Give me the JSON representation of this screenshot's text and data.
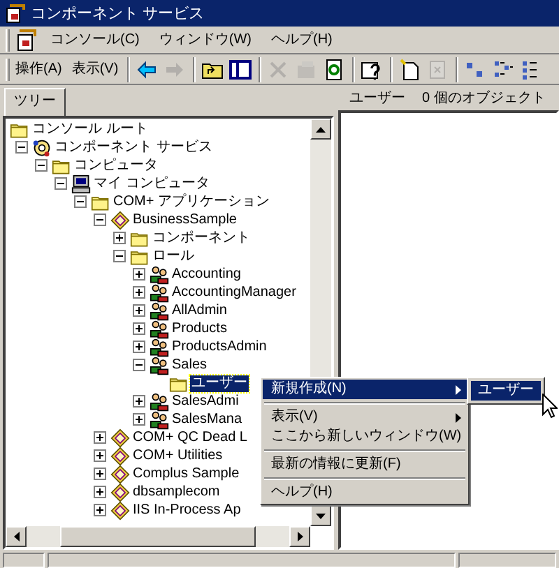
{
  "window": {
    "title": "コンポーネント サービス"
  },
  "menu_bar": [
    {
      "label": "コンソール(C)"
    },
    {
      "label": "ウィンドウ(W)"
    },
    {
      "label": "ヘルプ(H)"
    }
  ],
  "toolbar": {
    "menus": [
      {
        "label": "操作(A)"
      },
      {
        "label": "表示(V)"
      }
    ],
    "buttons": [
      {
        "kind": "back",
        "disabled": false
      },
      {
        "kind": "forward",
        "disabled": true
      },
      {
        "kind": "sep"
      },
      {
        "kind": "up",
        "disabled": false
      },
      {
        "kind": "tree",
        "disabled": false
      },
      {
        "kind": "sep"
      },
      {
        "kind": "delete",
        "disabled": true
      },
      {
        "kind": "properties",
        "disabled": true
      },
      {
        "kind": "refresh",
        "disabled": false
      },
      {
        "kind": "sep"
      },
      {
        "kind": "help",
        "disabled": false
      },
      {
        "kind": "sep"
      },
      {
        "kind": "new",
        "disabled": false
      },
      {
        "kind": "export",
        "disabled": true
      },
      {
        "kind": "sep"
      },
      {
        "kind": "large",
        "disabled": false
      },
      {
        "kind": "small",
        "disabled": false
      },
      {
        "kind": "list",
        "disabled": false
      }
    ]
  },
  "tree_tab": {
    "label": "ツリー",
    "selected": true
  },
  "tree": [
    {
      "label": "コンソール ルート",
      "kind": "folder",
      "selected": false,
      "children": [
        {
          "label": "コンポーネント サービス",
          "kind": "services",
          "expanded": true,
          "selected": false,
          "children": [
            {
              "label": "コンピュータ",
              "kind": "folder",
              "expanded": true,
              "selected": false,
              "children": [
                {
                  "label": "マイ コンピュータ",
                  "kind": "computer",
                  "expanded": true,
                  "selected": false,
                  "children": [
                    {
                      "label": "COM+ アプリケーション",
                      "kind": "folder",
                      "expanded": true,
                      "selected": false,
                      "children": [
                        {
                          "label": "BusinessSample",
                          "kind": "app",
                          "expanded": true,
                          "selected": false,
                          "children": [
                            {
                              "label": "コンポーネント",
                              "kind": "folder",
                              "expanded": false,
                              "selected": false
                            },
                            {
                              "label": "ロール",
                              "kind": "folder",
                              "expanded": true,
                              "selected": false,
                              "children": [
                                {
                                  "label": "Accounting",
                                  "kind": "role",
                                  "expanded": false,
                                  "selected": false
                                },
                                {
                                  "label": "AccountingManager",
                                  "kind": "role",
                                  "expanded": false,
                                  "selected": false
                                },
                                {
                                  "label": "AllAdmin",
                                  "kind": "role",
                                  "expanded": false,
                                  "selected": false
                                },
                                {
                                  "label": "Products",
                                  "kind": "role",
                                  "expanded": false,
                                  "selected": false
                                },
                                {
                                  "label": "ProductsAdmin",
                                  "kind": "role",
                                  "expanded": false,
                                  "selected": false
                                },
                                {
                                  "label": "Sales",
                                  "kind": "role",
                                  "expanded": true,
                                  "selected": false,
                                  "children": [
                                    {
                                      "label": "ユーザー",
                                      "kind": "folder",
                                      "selected": true
                                    }
                                  ]
                                },
                                {
                                  "label": "SalesAdmi",
                                  "kind": "role",
                                  "expanded": false,
                                  "selected": false
                                },
                                {
                                  "label": "SalesMana",
                                  "kind": "role",
                                  "expanded": false,
                                  "selected": false
                                }
                              ]
                            }
                          ]
                        },
                        {
                          "label": "COM+ QC Dead L",
                          "kind": "app",
                          "expanded": false,
                          "selected": false
                        },
                        {
                          "label": "COM+ Utilities",
                          "kind": "app",
                          "expanded": false,
                          "selected": false
                        },
                        {
                          "label": "Complus Sample",
                          "kind": "app",
                          "expanded": false,
                          "selected": false
                        },
                        {
                          "label": "dbsamplecom",
                          "kind": "app",
                          "expanded": false,
                          "selected": false
                        },
                        {
                          "label": "IIS In-Process Ap",
                          "kind": "app",
                          "expanded": false,
                          "selected": false
                        }
                      ]
                    }
                  ]
                }
              ]
            }
          ]
        }
      ]
    }
  ],
  "list_header": {
    "title": "ユーザー",
    "count": "0 個のオブジェクト"
  },
  "context_menu": {
    "items": [
      {
        "kind": "item",
        "label": "新規作成(N)",
        "submenu": true,
        "selected": true
      },
      {
        "kind": "separator"
      },
      {
        "kind": "item",
        "label": "表示(V)",
        "submenu": true,
        "selected": false
      },
      {
        "kind": "item",
        "label": "ここから新しいウィンドウ(W)",
        "submenu": false,
        "selected": false
      },
      {
        "kind": "separator"
      },
      {
        "kind": "item",
        "label": "最新の情報に更新(F)",
        "submenu": false,
        "selected": false
      },
      {
        "kind": "separator"
      },
      {
        "kind": "item",
        "label": "ヘルプ(H)",
        "submenu": false,
        "selected": false
      }
    ]
  },
  "submenu": {
    "items": [
      {
        "label": "ユーザー",
        "selected": true
      }
    ]
  }
}
